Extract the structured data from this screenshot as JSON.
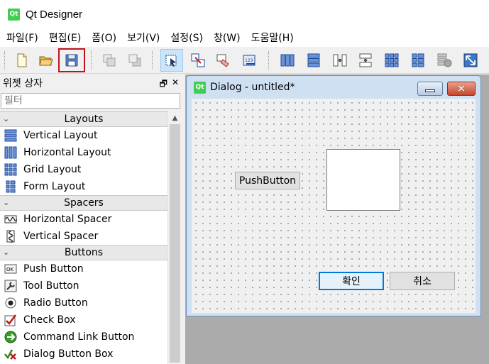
{
  "window": {
    "title": "Qt Designer",
    "logo_text": "Qt"
  },
  "menu": [
    {
      "label": "파일(F)"
    },
    {
      "label": "편집(E)"
    },
    {
      "label": "폼(O)"
    },
    {
      "label": "보기(V)"
    },
    {
      "label": "설정(S)"
    },
    {
      "label": "창(W)"
    },
    {
      "label": "도움말(H)"
    }
  ],
  "toolbar": {
    "items": [
      "new-form",
      "open-form",
      "save-form",
      "send-to-back",
      "bring-to-front",
      "edit-widgets",
      "edit-signals-slots",
      "edit-buddies",
      "edit-tab-order",
      "lay-out-horizontally",
      "lay-out-vertically",
      "lay-out-horizontal-splitter",
      "lay-out-vertical-splitter",
      "lay-out-grid",
      "lay-out-form",
      "break-layout",
      "adjust-size"
    ],
    "highlighted": "save-form",
    "active": "edit-widgets"
  },
  "widget_box": {
    "title": "위젯 상자",
    "filter_placeholder": "필터",
    "categories": [
      {
        "label": "Layouts",
        "items": [
          {
            "label": "Vertical Layout",
            "icon": "vertical-layout-icon"
          },
          {
            "label": "Horizontal Layout",
            "icon": "horizontal-layout-icon"
          },
          {
            "label": "Grid Layout",
            "icon": "grid-layout-icon"
          },
          {
            "label": "Form Layout",
            "icon": "form-layout-icon"
          }
        ]
      },
      {
        "label": "Spacers",
        "items": [
          {
            "label": "Horizontal Spacer",
            "icon": "horizontal-spacer-icon"
          },
          {
            "label": "Vertical Spacer",
            "icon": "vertical-spacer-icon"
          }
        ]
      },
      {
        "label": "Buttons",
        "items": [
          {
            "label": "Push Button",
            "icon": "push-button-icon",
            "icon_text": "OK"
          },
          {
            "label": "Tool Button",
            "icon": "tool-button-icon"
          },
          {
            "label": "Radio Button",
            "icon": "radio-button-icon"
          },
          {
            "label": "Check Box",
            "icon": "check-box-icon"
          },
          {
            "label": "Command Link Button",
            "icon": "command-link-icon"
          },
          {
            "label": "Dialog Button Box",
            "icon": "dialog-button-box-icon"
          }
        ]
      }
    ]
  },
  "dialog": {
    "title": "Dialog - untitled*",
    "logo_text": "Qt",
    "close_glyph": "✕",
    "push_button_label": "PushButton",
    "ok_label": "확인",
    "cancel_label": "취소"
  }
}
